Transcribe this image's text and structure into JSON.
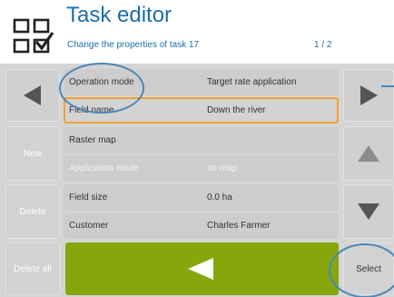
{
  "header": {
    "icon": "task-list-check-icon",
    "title": "Task editor",
    "subtitle": "Change the properties of task 17",
    "page": "1 / 2"
  },
  "left_buttons": {
    "prev_icon": "arrow-left-icon",
    "new_label": "New",
    "delete_label": "Delete",
    "delete_all_label": "Delete all"
  },
  "right_buttons": {
    "next_icon": "arrow-right-icon",
    "up_icon": "arrow-up-icon",
    "down_icon": "arrow-down-icon",
    "select_label": "Select"
  },
  "rows": [
    {
      "label": "Operation mode",
      "value": "Target rate application"
    },
    {
      "label": "Field name",
      "value": "Down the river"
    },
    {
      "label": "Raster map",
      "value": ""
    },
    {
      "label": "Application mode",
      "value": "no map"
    },
    {
      "label": "Field size",
      "value": "0.0 ha"
    },
    {
      "label": "Customer",
      "value": "Charles Farmer"
    }
  ],
  "confirm_button": {
    "icon": "play-back-icon",
    "color": "#86a60c"
  },
  "colors": {
    "accent": "#1b6eab",
    "selection": "#f0a030",
    "annotation": "#4b86b8"
  }
}
